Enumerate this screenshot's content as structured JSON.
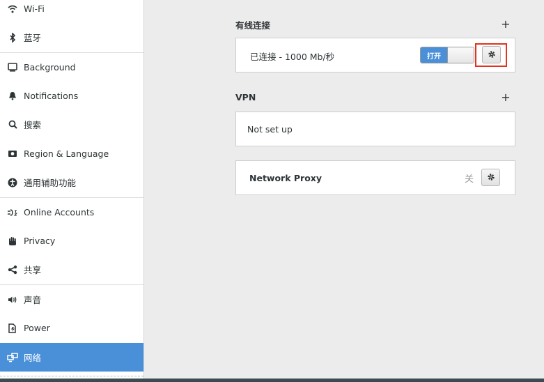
{
  "sidebar": {
    "items": [
      {
        "label": "Wi-Fi",
        "icon": "wifi-icon"
      },
      {
        "label": "蓝牙",
        "icon": "bluetooth-icon"
      },
      {
        "label": "Background",
        "icon": "background-icon"
      },
      {
        "label": "Notifications",
        "icon": "bell-icon"
      },
      {
        "label": "搜索",
        "icon": "search-icon"
      },
      {
        "label": "Region & Language",
        "icon": "region-icon"
      },
      {
        "label": "通用辅助功能",
        "icon": "accessibility-icon"
      },
      {
        "label": "Online Accounts",
        "icon": "online-accounts-icon"
      },
      {
        "label": "Privacy",
        "icon": "privacy-hand-icon"
      },
      {
        "label": "共享",
        "icon": "share-icon"
      },
      {
        "label": "声音",
        "icon": "speaker-icon"
      },
      {
        "label": "Power",
        "icon": "power-icon"
      },
      {
        "label": "网络",
        "icon": "network-icon",
        "selected": true
      }
    ]
  },
  "wired": {
    "title": "有线连接",
    "add": "+",
    "status": "已连接 - 1000 Mb/秒",
    "switch_label": "打开",
    "switch_on": true
  },
  "vpn": {
    "title": "VPN",
    "add": "+",
    "status": "Not set up"
  },
  "proxy": {
    "title": "Network Proxy",
    "state": "关"
  },
  "colors": {
    "accent": "#4a90d9",
    "highlight": "#e0341f",
    "background": "#ececec"
  }
}
